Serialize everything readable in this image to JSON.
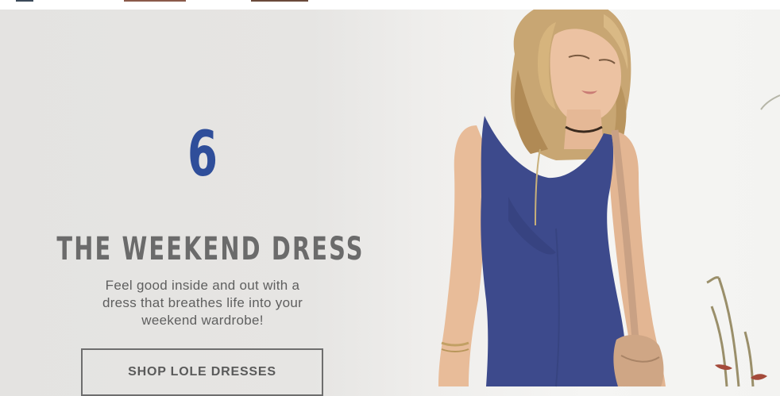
{
  "promo": {
    "number": "6",
    "title": "THE WEEKEND DRESS",
    "description": "Feel good inside and out with a\ndress that breathes life into your\nweekend wardrobe!",
    "cta_label": "SHOP LOLE DRESSES"
  },
  "colors": {
    "accent_blue": "#2f4e9a",
    "title_gray": "#6b6b6b",
    "background": "#e6e5e3"
  }
}
